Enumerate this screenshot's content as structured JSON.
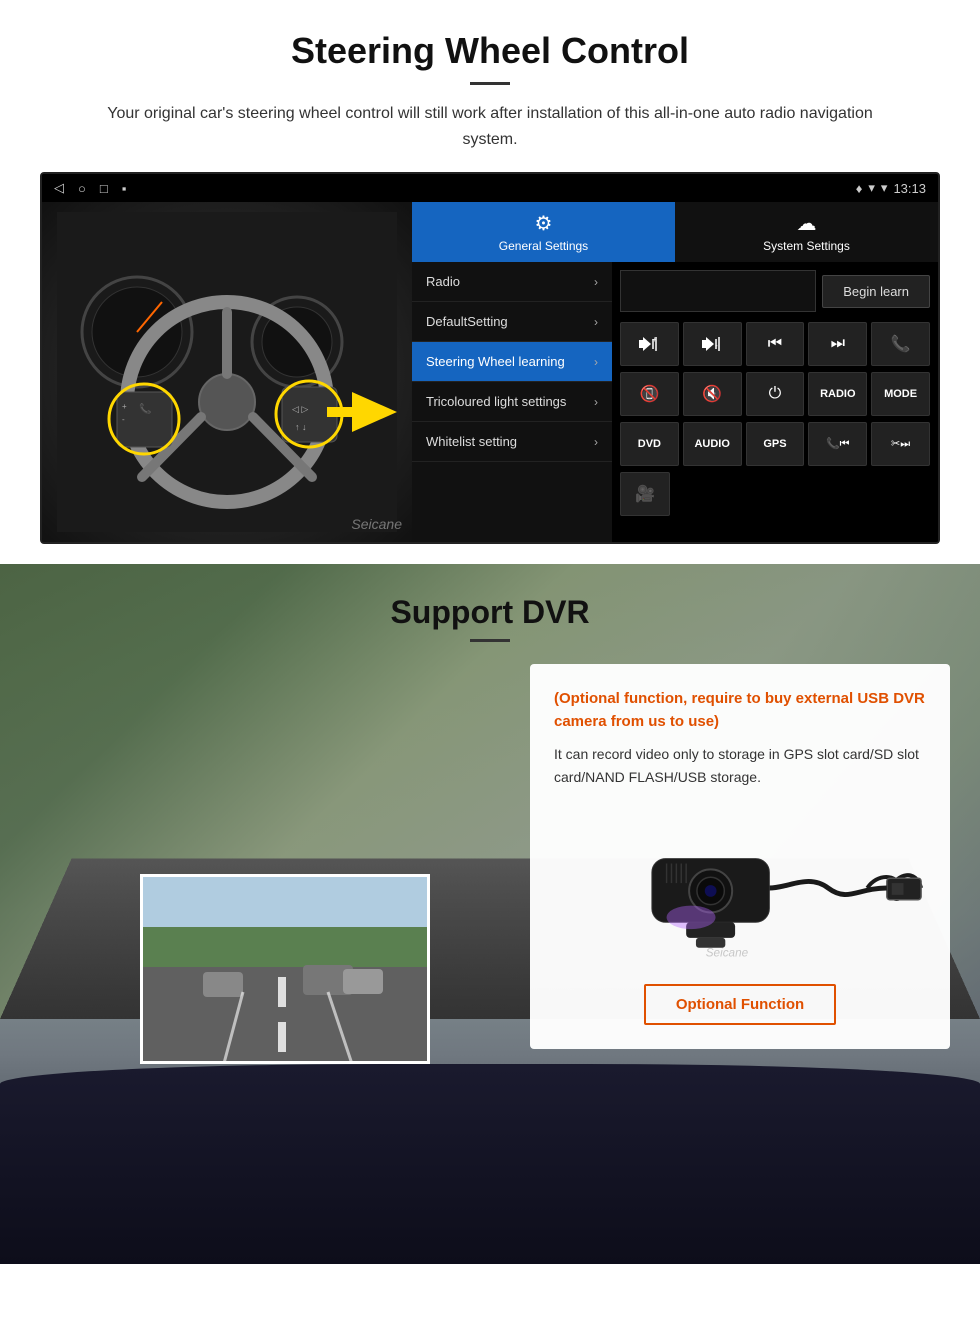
{
  "section1": {
    "title": "Steering Wheel Control",
    "subtitle": "Your original car's steering wheel control will still work after installation of this all-in-one auto radio navigation system.",
    "statusbar": {
      "nav_back": "◁",
      "nav_home": "○",
      "nav_square": "□",
      "nav_menu": "▪",
      "signal": "▼",
      "wifi": "▼",
      "time": "13:13"
    },
    "tabs": {
      "general": {
        "icon": "⚙",
        "label": "General Settings"
      },
      "system": {
        "icon": "☁",
        "label": "System Settings"
      }
    },
    "menu_items": [
      {
        "label": "Radio",
        "active": false
      },
      {
        "label": "DefaultSetting",
        "active": false
      },
      {
        "label": "Steering Wheel learning",
        "active": true
      },
      {
        "label": "Tricoloured light settings",
        "active": false
      },
      {
        "label": "Whitelist setting",
        "active": false
      }
    ],
    "begin_learn_label": "Begin learn",
    "controls": {
      "row1": [
        "🔊+",
        "🔊-",
        "⏮",
        "⏭",
        "📞"
      ],
      "row2": [
        "📞",
        "🔇",
        "⏻",
        "RADIO",
        "MODE"
      ],
      "row3": [
        "DVD",
        "AUDIO",
        "GPS",
        "📞⏮",
        "✂⏭"
      ],
      "row4": [
        "🎥"
      ]
    }
  },
  "section2": {
    "title": "Support DVR",
    "optional_text": "(Optional function, require to buy external USB DVR camera from us to use)",
    "description": "It can record video only to storage in GPS slot card/SD slot card/NAND FLASH/USB storage.",
    "optional_function_label": "Optional Function",
    "watermark": "Seicane"
  }
}
